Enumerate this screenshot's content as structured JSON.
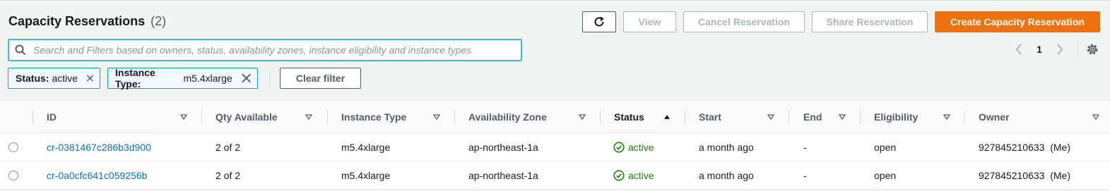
{
  "header": {
    "title": "Capacity Reservations",
    "count": "(2)"
  },
  "toolbar": {
    "refresh_icon": "refresh-icon",
    "view_label": "View",
    "cancel_label": "Cancel Reservation",
    "share_label": "Share Reservation",
    "create_label": "Create Capacity Reservation",
    "create_color": "#ec7211"
  },
  "search": {
    "placeholder": "Search and Filters based on owners, status, availability zones, instance eligibility and instance types",
    "value": ""
  },
  "pagination": {
    "page": "1"
  },
  "filters": [
    {
      "key": "Status:",
      "value": "active"
    },
    {
      "key": "Instance Type:",
      "value": "m5.4xlarge"
    }
  ],
  "clear_filter_label": "Clear filter",
  "table": {
    "columns": [
      "ID",
      "Qty Available",
      "Instance Type",
      "Availability Zone",
      "Status",
      "Start",
      "End",
      "Eligibility",
      "Owner"
    ],
    "rows": [
      {
        "id": "cr-0381467c286b3d900",
        "qty": "2 of 2",
        "instance_type": "m5.4xlarge",
        "az": "ap-northeast-1a",
        "status": "active",
        "start": "a month ago",
        "end": "-",
        "eligibility": "open",
        "owner": "927845210633",
        "owner_tag": "(Me)"
      },
      {
        "id": "cr-0a0cfc641c059256b",
        "qty": "2 of 2",
        "instance_type": "m5.4xlarge",
        "az": "ap-northeast-1a",
        "status": "active",
        "start": "a month ago",
        "end": "-",
        "eligibility": "open",
        "owner": "927845210633",
        "owner_tag": "(Me)"
      }
    ],
    "sorted_column": "Status",
    "link_color": "#0073bb",
    "status_color": "#1d8102"
  }
}
